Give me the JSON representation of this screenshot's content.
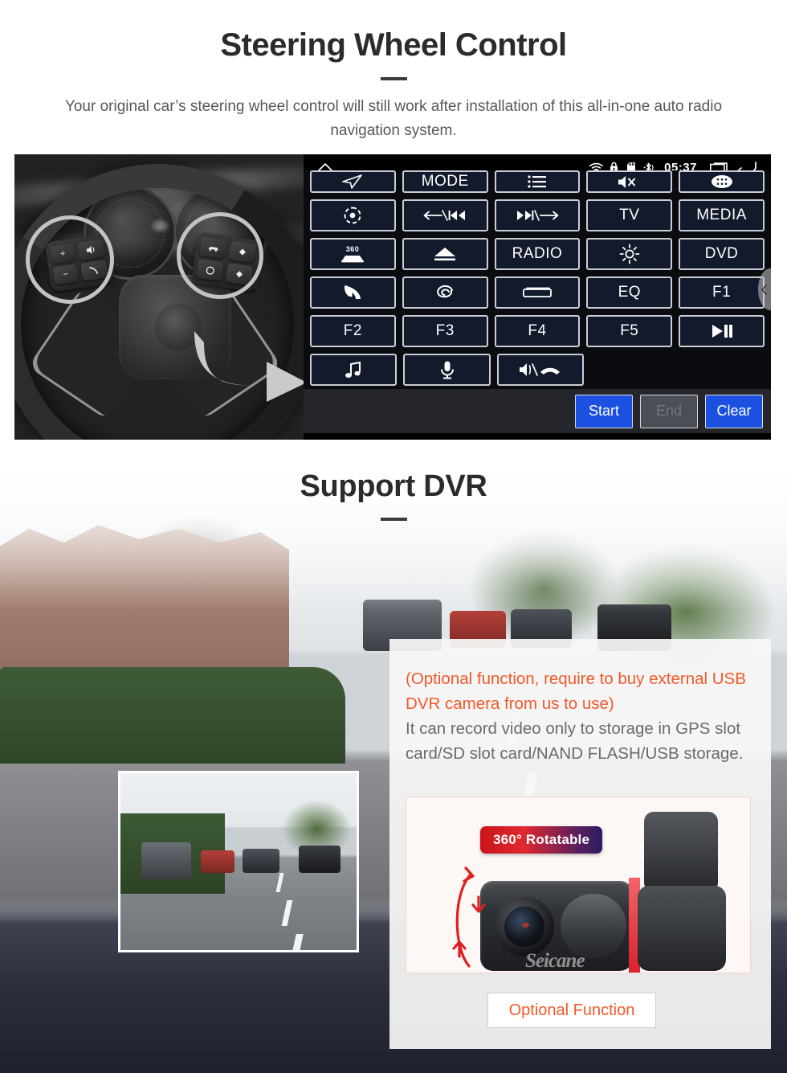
{
  "section1": {
    "title": "Steering Wheel Control",
    "subtitle": "Your original car’s steering wheel control will still work after installation of this all-in-one auto radio navigation system."
  },
  "head_unit": {
    "status_bar": {
      "home_icon": "home-icon",
      "wifi_icon": "wifi-icon",
      "lock_icon": "lock-icon",
      "sdcard_icon": "sd-card-icon",
      "bluetooth_icon": "bluetooth-icon",
      "time": "05:37",
      "recents_icon": "recents-icon",
      "back_icon": "back-icon"
    },
    "rows": [
      [
        {
          "label": "",
          "icon": "navigation-arrow-icon"
        },
        {
          "label": "MODE",
          "icon": ""
        },
        {
          "label": "",
          "icon": "list-menu-icon"
        },
        {
          "label": "",
          "icon": "mute-speaker-icon"
        },
        {
          "label": "",
          "icon": "apps-grid-icon"
        }
      ],
      [
        {
          "label": "",
          "icon": "power-eye-icon"
        },
        {
          "label": "",
          "icon": "previous-track-icon"
        },
        {
          "label": "",
          "icon": "next-track-icon"
        },
        {
          "label": "TV",
          "icon": ""
        },
        {
          "label": "MEDIA",
          "icon": ""
        }
      ],
      [
        {
          "label": "",
          "icon": "360-car-icon"
        },
        {
          "label": "",
          "icon": "eject-icon"
        },
        {
          "label": "RADIO",
          "icon": ""
        },
        {
          "label": "",
          "icon": "brightness-icon"
        },
        {
          "label": "DVD",
          "icon": ""
        }
      ],
      [
        {
          "label": "",
          "icon": "phone-call-icon"
        },
        {
          "label": "",
          "icon": "swirl-icon"
        },
        {
          "label": "",
          "icon": "screen-icon"
        },
        {
          "label": "EQ",
          "icon": ""
        },
        {
          "label": "F1",
          "icon": ""
        }
      ],
      [
        {
          "label": "F2",
          "icon": ""
        },
        {
          "label": "F3",
          "icon": ""
        },
        {
          "label": "F4",
          "icon": ""
        },
        {
          "label": "F5",
          "icon": ""
        },
        {
          "label": "",
          "icon": "play-pause-icon"
        }
      ],
      [
        {
          "label": "",
          "icon": "music-note-icon"
        },
        {
          "label": "",
          "icon": "microphone-icon"
        },
        {
          "label": "",
          "icon": "volume-hangup-icon"
        },
        {
          "label": "",
          "icon": ""
        },
        {
          "label": "",
          "icon": ""
        }
      ]
    ],
    "footer_buttons": [
      {
        "label": "Start",
        "state": "primary"
      },
      {
        "label": "End",
        "state": "disabled"
      },
      {
        "label": "Clear",
        "state": "primary"
      }
    ],
    "drawer_handle_icon": "chevron-left-icon"
  },
  "section2": {
    "title": "Support DVR",
    "info": {
      "highlight": "(Optional function, require to buy external USB DVR camera from us to use)",
      "body": "It can record video only to storage in GPS slot card/SD slot card/NAND FLASH/USB storage.",
      "badge": "360° Rotatable",
      "watermark": "Seicane",
      "optional_button": "Optional Function"
    }
  },
  "colors": {
    "accent_orange": "#f1592a",
    "button_blue": "#1b50e0",
    "highlight_yellow": "#f5c518",
    "badge_red": "#c9151c",
    "badge_purple": "#2b1d5e",
    "panel_navy": "#121a2b",
    "text_dark": "#2b2b2b",
    "text_grey": "#6b6b6b"
  }
}
